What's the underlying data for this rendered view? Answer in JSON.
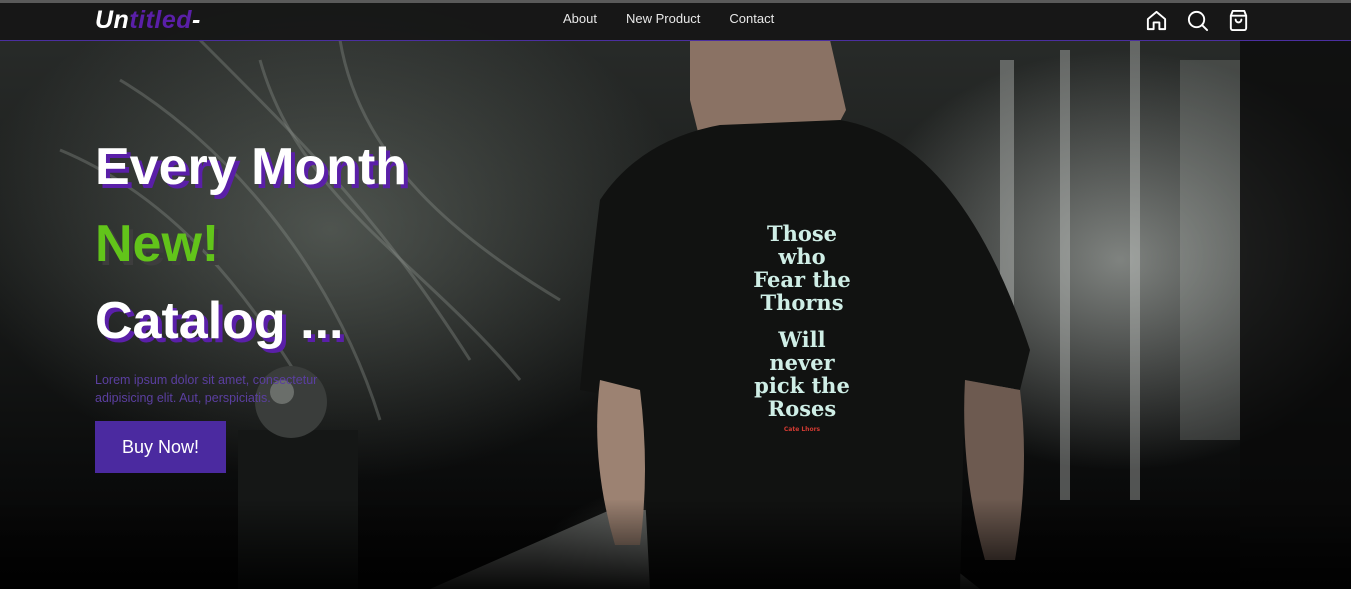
{
  "brand": {
    "prefix": "Un",
    "accent": "titled",
    "suffix": "-"
  },
  "nav": {
    "links": [
      "About",
      "New Product",
      "Contact"
    ],
    "icons": [
      "home-icon",
      "search-icon",
      "cart-icon"
    ]
  },
  "hero": {
    "line1": "Every Month",
    "line2": "New!",
    "line3": "Catalog ...",
    "description": "Lorem ipsum dolor sit amet, consectetur adipisicing elit. Aut, perspiciatis.",
    "cta_label": "Buy Now!"
  },
  "shirt_print": {
    "lines": [
      "Those",
      "who",
      "Fear the",
      "Thorns",
      "Will",
      "never",
      "pick the",
      "Roses"
    ],
    "signature": "Cate Lhors"
  },
  "colors": {
    "brand_accent": "#5a1fa8",
    "new_green": "#62c41a",
    "button": "#4b2aa0",
    "nav_border": "#4b2fa0"
  }
}
